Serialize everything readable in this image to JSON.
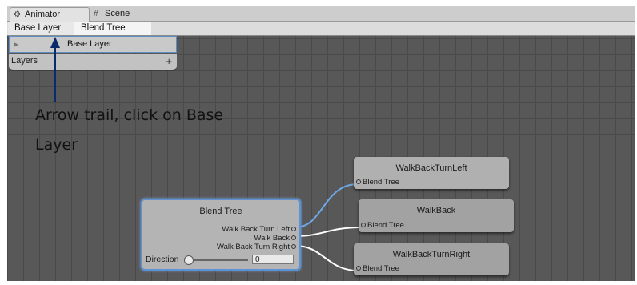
{
  "tabs": [
    {
      "label": "Animator",
      "icon": "animator-icon"
    },
    {
      "label": "Scene",
      "icon": "grid-icon"
    }
  ],
  "breadcrumb": [
    "Base Layer",
    "Blend Tree"
  ],
  "layers_panel": {
    "row_label": "Base Layer",
    "footer_label": "Layers",
    "add_symbol": "+"
  },
  "annotation": {
    "line1": "Arrow trail, click on Base",
    "line2": "Layer",
    "color": "#0b2a6b"
  },
  "blend_tree": {
    "title": "Blend Tree",
    "outputs": [
      "Walk Back Turn Left",
      "Walk Back",
      "Walk Back Turn Right"
    ],
    "parameter": {
      "label": "Direction",
      "value": "0"
    }
  },
  "motion_nodes": [
    {
      "title": "WalkBackTurnLeft",
      "input_label": "Blend Tree"
    },
    {
      "title": "WalkBack",
      "input_label": "Blend Tree"
    },
    {
      "title": "WalkBackTurnRight",
      "input_label": "Blend Tree"
    }
  ],
  "colors": {
    "selection_blue": "#5d93d6",
    "active_wire": "#6fa8e8",
    "wire": "#ffffff"
  }
}
